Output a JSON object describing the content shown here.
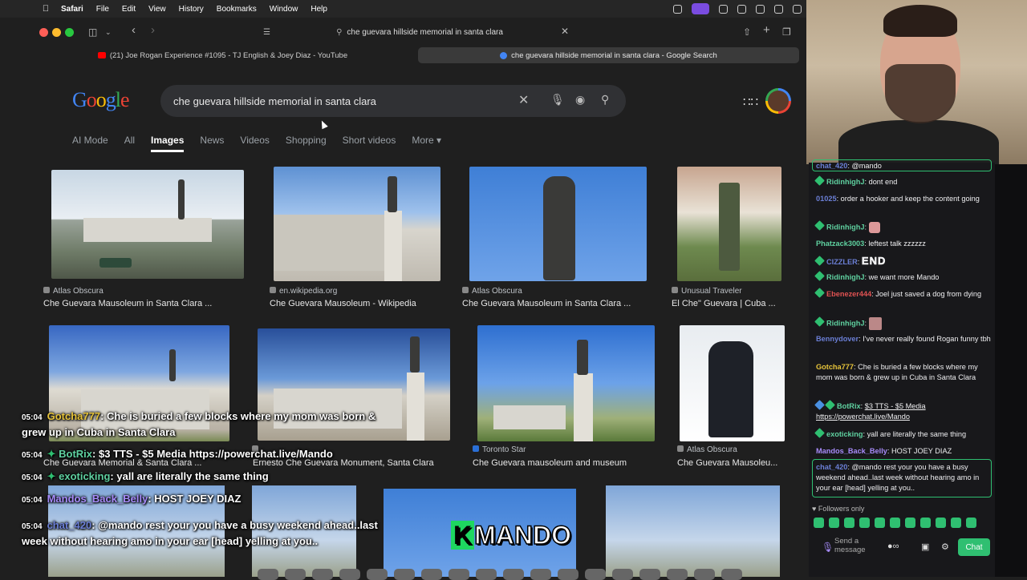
{
  "menubar": {
    "app": "Safari",
    "items": [
      "File",
      "Edit",
      "View",
      "History",
      "Bookmarks",
      "Window",
      "Help"
    ]
  },
  "toolbar": {
    "address": "che guevara hillside memorial in santa clara"
  },
  "tabs": [
    {
      "label": "(21) Joe Rogan Experience #1095 - TJ English & Joey Diaz - YouTube",
      "active": false,
      "fav_color": "#ff0000"
    },
    {
      "label": "che guevara hillside memorial in santa clara - Google Search",
      "active": true,
      "fav_color": "#4285f4"
    }
  ],
  "google": {
    "logo": "Google",
    "query": "che guevara hillside memorial in santa clara",
    "tabs": [
      "AI Mode",
      "All",
      "Images",
      "News",
      "Videos",
      "Shopping",
      "Short videos",
      "More"
    ],
    "active_tab": "Images"
  },
  "results": [
    {
      "source": "Atlas Obscura",
      "title": "Che Guevara Mausoleum in Santa Clara ..."
    },
    {
      "source": "en.wikipedia.org",
      "title": "Che Guevara Mausoleum - Wikipedia"
    },
    {
      "source": "Atlas Obscura",
      "title": "Che Guevara Mausoleum in Santa Clara ..."
    },
    {
      "source": "Unusual Traveler",
      "title": "El Che\" Guevara | Cuba ..."
    },
    {
      "source": "",
      "title": "Che Guevara Memorial & Santa Clara ..."
    },
    {
      "source": "",
      "title": "Ernesto Che Guevara Monument, Santa Clara"
    },
    {
      "source": "Toronto Star",
      "title": "Che Guevara mausoleum and museum"
    },
    {
      "source": "Atlas Obscura",
      "title": "Che Guevara Mausoleu..."
    }
  ],
  "overlay_chat": [
    {
      "time": "05:04",
      "user": "Gotcha777",
      "sep": ":",
      "text": "Che is buried a few blocks where my mom was born &",
      "cont": "grew up in Cuba in Santa Clara",
      "color": "#e6c33a"
    },
    {
      "time": "05:04",
      "user": "BotRix",
      "sep": ":",
      "text": "$3 TTS - $5 Media https://powerchat.live/Mando",
      "color": "#5fd1a0"
    },
    {
      "time": "05:04",
      "user": "exoticking",
      "sep": ":",
      "text": "yall are literally the same thing",
      "color": "#5fd1a0"
    },
    {
      "time": "05:04",
      "user": "Mandos_Back_Belly",
      "sep": ":",
      "text": "HOST JOEY DIAZ",
      "color": "#a78bfa"
    },
    {
      "time": "05:04",
      "user": "chat_420",
      "sep": ":",
      "text": "@mando rest your you have a busy weekend ahead..last",
      "cont": "week without hearing amo in your ear [head] yelling at you..",
      "color": "#6b7fd6"
    }
  ],
  "overlay_badge": {
    "k": "K",
    "text": "MANDO"
  },
  "chat_panel": {
    "messages": [
      {
        "user": "chat_420",
        "text": "@mando",
        "color": "#6b7fd6"
      },
      {
        "user": "RidinhighJ",
        "text": "dont end",
        "color": "#5fd1a0"
      },
      {
        "user": "01025",
        "text": "order a hooker and keep the content going",
        "color": "#6b7fd6"
      },
      {
        "user": "RidinhighJ",
        "text": "",
        "color": "#5fd1a0"
      },
      {
        "user": "Phatzack3003",
        "text": "leftest talk zzzzzz",
        "color": "#5fd1a0"
      },
      {
        "user": "CIZZLER",
        "text": "END",
        "color": "#6b7fd6"
      },
      {
        "user": "RidinhighJ",
        "text": "we want more Mando",
        "color": "#5fd1a0"
      },
      {
        "user": "Ebenezer444",
        "text": "Joel just saved a dog from dying",
        "color": "#e05252"
      },
      {
        "user": "RidinhighJ",
        "text": "",
        "color": "#5fd1a0"
      },
      {
        "user": "Bennydover",
        "text": "I've never really found Rogan funny tbh",
        "color": "#6b7fd6"
      },
      {
        "user": "Gotcha777",
        "text": "Che is buried a few blocks where my mom was born & grew up in Cuba in Santa Clara",
        "color": "#e6c33a"
      },
      {
        "user": "BotRix",
        "text": "$3 TTS - $5 Media https://powerchat.live/Mando",
        "color": "#5fd1a0"
      },
      {
        "user": "exoticking",
        "text": "yall are literally the same thing",
        "color": "#5fd1a0"
      },
      {
        "user": "Mandos_Back_Belly",
        "text": "HOST JOEY DIAZ",
        "color": "#a78bfa"
      },
      {
        "user": "chat_420",
        "text": "@mando rest your you have a busy weekend ahead..last week without hearing amo in your ear [head] yelling at you..",
        "color": "#6b7fd6"
      }
    ],
    "followers_only": "Followers only",
    "send_placeholder": "Send a message",
    "chat_button": "Chat"
  }
}
